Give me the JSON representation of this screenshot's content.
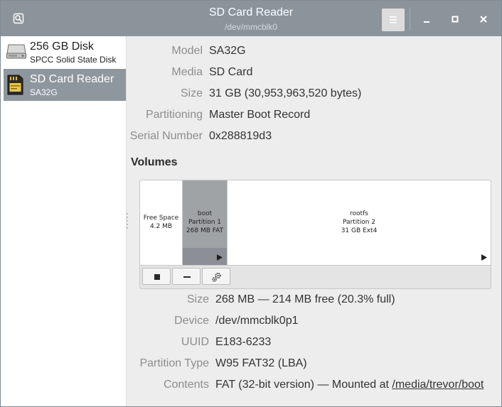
{
  "window": {
    "title": "SD Card Reader",
    "subtitle": "/dev/mmcblk0"
  },
  "sidebar": {
    "drives": [
      {
        "name": "256 GB Disk",
        "subtitle": "SPCC Solid State Disk",
        "icon": "hard-disk-icon",
        "selected": false
      },
      {
        "name": "SD Card Reader",
        "subtitle": "SA32G",
        "icon": "sd-card-icon",
        "selected": true
      }
    ]
  },
  "drive_info": {
    "model_label": "Model",
    "model_value": "SA32G",
    "media_label": "Media",
    "media_value": "SD Card",
    "size_label": "Size",
    "size_value": "31 GB (30,953,963,520 bytes)",
    "partitioning_label": "Partitioning",
    "partitioning_value": "Master Boot Record",
    "serial_label": "Serial Number",
    "serial_value": "0x288819d3"
  },
  "volumes": {
    "heading": "Volumes",
    "segments": [
      {
        "line1": "Free Space",
        "line2": "4.2 MB"
      },
      {
        "line1": "boot",
        "line2": "Partition 1",
        "line3": "268 MB FAT",
        "selected": true
      },
      {
        "line1": "rootfs",
        "line2": "Partition 2",
        "line3": "31 GB Ext4"
      }
    ],
    "tools": [
      "stop-icon",
      "minus-icon",
      "gears-icon"
    ]
  },
  "partition_info": {
    "size_label": "Size",
    "size_value": "268 MB — 214 MB free (20.3% full)",
    "device_label": "Device",
    "device_value": "/dev/mmcblk0p1",
    "uuid_label": "UUID",
    "uuid_value": "E183-6233",
    "type_label": "Partition Type",
    "type_value": "W95 FAT32 (LBA)",
    "contents_label": "Contents",
    "contents_prefix": "FAT (32-bit version) — Mounted at ",
    "contents_link": "/media/trevor/boot"
  },
  "colors": {
    "titlebar": "#8b949b",
    "selection": "#8e969e",
    "panel": "#ededed"
  }
}
